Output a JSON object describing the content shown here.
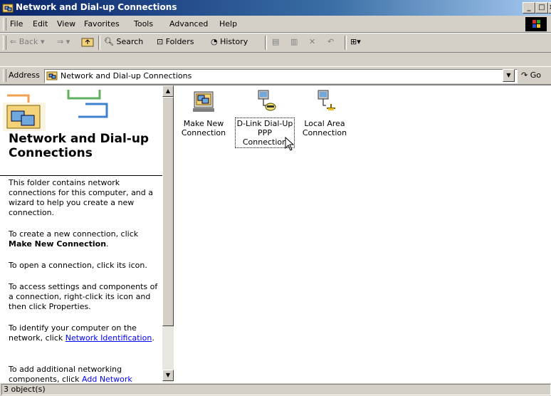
{
  "window": {
    "title": "Network and Dial-up Connections",
    "title_icon": "network-folder-icon",
    "controls": [
      "minimize-icon",
      "maximize-icon",
      "close-icon"
    ]
  },
  "menu": {
    "items": [
      "File",
      "Edit",
      "View",
      "Favorites",
      "Tools",
      "Advanced",
      "Help"
    ]
  },
  "toolbar": {
    "back": "Back",
    "search": "Search",
    "folders": "Folders",
    "history": "History"
  },
  "address": {
    "label": "Address",
    "value": "Network and Dial-up Connections",
    "go": "Go"
  },
  "left_pane": {
    "title": "Network and Dial-up Connections",
    "para1": "This folder contains network connections for this computer, and a wizard to help you create a new connection.",
    "para2_prefix": "To create a new connection, click ",
    "para2_bold": "Make New Connection",
    "para2_suffix": ".",
    "para3": "To open a connection, click its icon.",
    "para4": "To access settings and components of a connection, right-click its icon and then click Properties.",
    "para5_prefix": "To identify your computer on the network, click ",
    "para5_link": "Network Identification",
    "para5_suffix": ".",
    "para6_prefix": "To add additional networking components, click ",
    "para6_link": "Add Network"
  },
  "icons": [
    {
      "name": "Make New Connection",
      "line1": "Make New",
      "line2": "Connection",
      "icon": "make-new-connection-icon"
    },
    {
      "name": "D-Link Dial-Up PPP Connection",
      "line1": "D-Link Dial-Up",
      "line2": "PPP",
      "line3": "Connection",
      "icon": "dialup-connection-icon",
      "selected": true
    },
    {
      "name": "Local Area Connection",
      "line1": "Local Area",
      "line2": "Connection",
      "icon": "lan-connection-icon"
    }
  ],
  "status": {
    "text": "3 object(s)"
  },
  "colors": {
    "title_start": "#0a246a",
    "title_end": "#a6caf0",
    "face": "#d4d0c8",
    "link": "#0000ff"
  }
}
